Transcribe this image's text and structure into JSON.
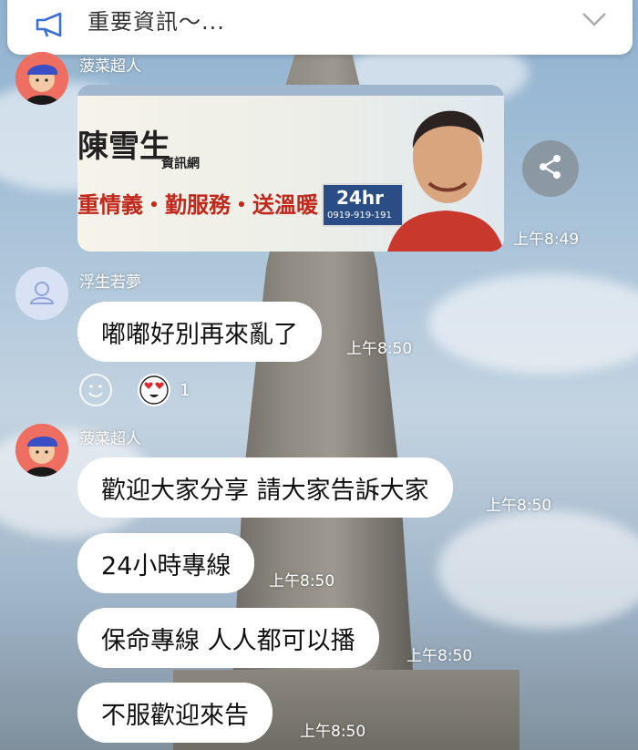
{
  "notice": {
    "text": "重要資訊〜..."
  },
  "messages": [
    {
      "sender": "菠菜超人",
      "type": "image",
      "time": "上午8:49",
      "banner": {
        "title": "陳雪生",
        "subtitle": "資訊網",
        "slogan": "重情義・勤服務・送溫暖",
        "hotline_big": "24hr",
        "hotline_small": "0919-919-191"
      }
    },
    {
      "sender": "浮生若夢",
      "text": "嘟嘟好別再來亂了",
      "time": "上午8:50",
      "reaction": {
        "count": "1"
      }
    },
    {
      "sender": "菠菜超人",
      "text": "歡迎大家分享 請大家告訴大家",
      "time": "上午8:50"
    },
    {
      "text": "24小時專線",
      "time": "上午8:50"
    },
    {
      "text": "保命專線 人人都可以播",
      "time": "上午8:50"
    },
    {
      "text": "不服歡迎來告",
      "time": "上午8:50"
    }
  ],
  "icons": {
    "notice": "megaphone-icon",
    "expand": "chevron-down-icon",
    "share": "share-icon",
    "add_reaction": "smiley-icon"
  },
  "colors": {
    "bubble": "#ffffff",
    "avatar_red": "#ee6e62",
    "avatar_blue": "#d9e2f5"
  }
}
